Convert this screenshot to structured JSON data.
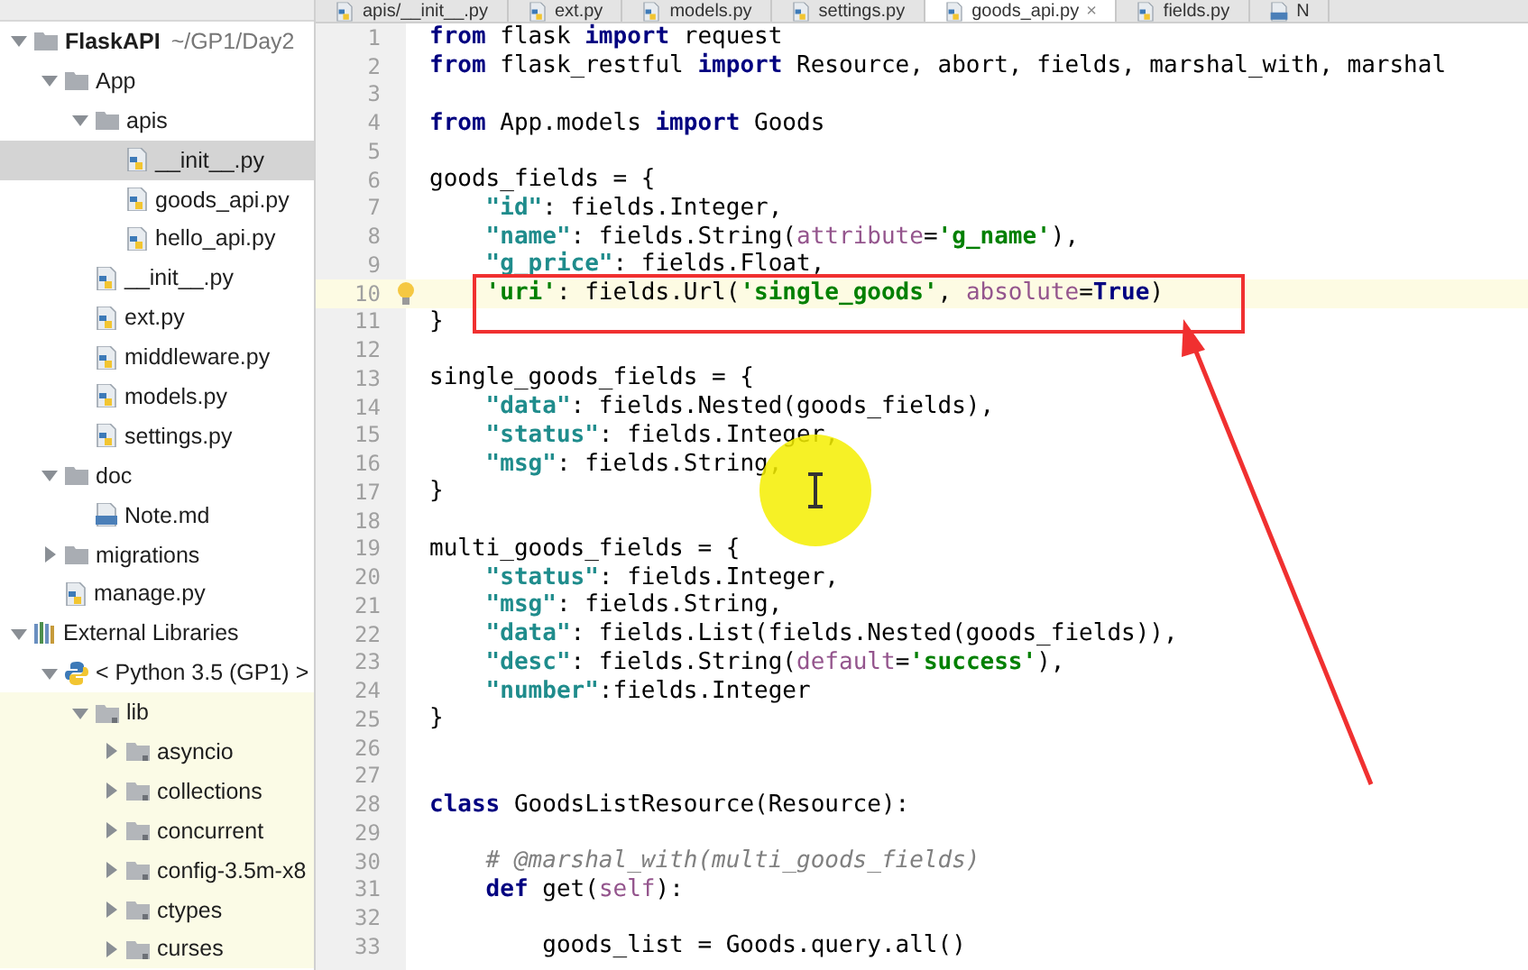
{
  "tabs": [
    {
      "label": "apis/__init__.py",
      "kind": "python",
      "selected": false
    },
    {
      "label": "ext.py",
      "kind": "python",
      "selected": false
    },
    {
      "label": "models.py",
      "kind": "python",
      "selected": false
    },
    {
      "label": "settings.py",
      "kind": "python",
      "selected": false
    },
    {
      "label": "goods_api.py",
      "kind": "python",
      "selected": true,
      "close": "×"
    },
    {
      "label": "fields.py",
      "kind": "python",
      "selected": false
    },
    {
      "label": "N",
      "kind": "md",
      "selected": false
    }
  ],
  "tree": [
    {
      "label": "FlaskAPI",
      "path": "~/GP1/Day2",
      "kind": "folder",
      "expanded": true,
      "selected": false,
      "children": [
        {
          "label": "App",
          "kind": "folder",
          "expanded": true,
          "selected": false,
          "children": [
            {
              "label": "apis",
              "kind": "folder",
              "expanded": true,
              "selected": false,
              "children": [
                {
                  "label": "__init__.py",
                  "kind": "python",
                  "selected": true
                },
                {
                  "label": "goods_api.py",
                  "kind": "python",
                  "selected": false
                },
                {
                  "label": "hello_api.py",
                  "kind": "python",
                  "selected": false
                }
              ]
            },
            {
              "label": "__init__.py",
              "kind": "python",
              "selected": false
            },
            {
              "label": "ext.py",
              "kind": "python",
              "selected": false
            },
            {
              "label": "middleware.py",
              "kind": "python",
              "selected": false
            },
            {
              "label": "models.py",
              "kind": "python",
              "selected": false
            },
            {
              "label": "settings.py",
              "kind": "python",
              "selected": false
            }
          ]
        },
        {
          "label": "doc",
          "kind": "folder",
          "expanded": true,
          "selected": false,
          "children": [
            {
              "label": "Note.md",
              "kind": "md",
              "selected": false
            }
          ]
        },
        {
          "label": "migrations",
          "kind": "folder",
          "expanded": false,
          "selected": false
        },
        {
          "label": "manage.py",
          "kind": "python",
          "selected": false
        }
      ]
    },
    {
      "label": "External Libraries",
      "kind": "library",
      "expanded": true,
      "selected": false,
      "children": [
        {
          "label": "< Python 3.5 (GP1) >",
          "kind": "sdk",
          "expanded": true,
          "selected": false,
          "children": [
            {
              "label": "lib",
              "kind": "libfolder",
              "expanded": true,
              "selected": false,
              "children": [
                {
                  "label": "asyncio",
                  "kind": "libfolder",
                  "expanded": false,
                  "selected": false
                },
                {
                  "label": "collections",
                  "kind": "libfolder",
                  "expanded": false,
                  "selected": false
                },
                {
                  "label": "concurrent",
                  "kind": "libfolder",
                  "expanded": false,
                  "selected": false
                },
                {
                  "label": "config-3.5m-x8",
                  "kind": "libfolder",
                  "expanded": false,
                  "selected": false
                },
                {
                  "label": "ctypes",
                  "kind": "libfolder",
                  "expanded": false,
                  "selected": false
                },
                {
                  "label": "curses",
                  "kind": "libfolder",
                  "expanded": false,
                  "selected": false
                }
              ]
            }
          ]
        }
      ]
    }
  ],
  "code_lines": [
    {
      "number": "1",
      "tokens": [
        {
          "kind": "kw",
          "text": "from"
        },
        {
          "kind": "plain",
          "text": " flask "
        },
        {
          "kind": "kw",
          "text": "import"
        },
        {
          "kind": "plain",
          "text": " request"
        }
      ]
    },
    {
      "number": "2",
      "tokens": [
        {
          "kind": "kw",
          "text": "from"
        },
        {
          "kind": "plain",
          "text": " flask_restful "
        },
        {
          "kind": "kw",
          "text": "import"
        },
        {
          "kind": "plain",
          "text": " Resource, abort, fields, marshal_with, marshal"
        }
      ]
    },
    {
      "number": "3"
    },
    {
      "number": "4",
      "tokens": [
        {
          "kind": "kw",
          "text": "from"
        },
        {
          "kind": "plain",
          "text": " App.models "
        },
        {
          "kind": "kw",
          "text": "import"
        },
        {
          "kind": "plain",
          "text": " Goods"
        }
      ]
    },
    {
      "number": "5"
    },
    {
      "number": "6",
      "tokens": [
        {
          "kind": "plain",
          "text": "goods_fields = {"
        }
      ]
    },
    {
      "number": "7",
      "tokens": [
        {
          "kind": "key",
          "text": "    \"id\""
        },
        {
          "kind": "plain",
          "text": ": fields.Integer,"
        }
      ]
    },
    {
      "number": "8",
      "tokens": [
        {
          "kind": "key",
          "text": "    \"name\""
        },
        {
          "kind": "plain",
          "text": ": fields.String("
        },
        {
          "kind": "param",
          "text": "attribute"
        },
        {
          "kind": "plain",
          "text": "="
        },
        {
          "kind": "str",
          "text": "'g_name'"
        },
        {
          "kind": "plain",
          "text": "),"
        }
      ]
    },
    {
      "number": "9",
      "tokens": [
        {
          "kind": "key",
          "text": "    \"g_price\""
        },
        {
          "kind": "plain",
          "text": ": fields.Float,"
        }
      ]
    },
    {
      "number": "10",
      "current": true,
      "hint": true,
      "tokens": [
        {
          "kind": "str",
          "text": "    'uri'"
        },
        {
          "kind": "plain",
          "text": ": fields.Url("
        },
        {
          "kind": "str",
          "text": "'single_goods'"
        },
        {
          "kind": "plain",
          "text": ", "
        },
        {
          "kind": "param",
          "text": "absolute"
        },
        {
          "kind": "plain",
          "text": "="
        },
        {
          "kind": "kw",
          "text": "True"
        },
        {
          "kind": "plain",
          "text": ")"
        }
      ]
    },
    {
      "number": "11",
      "tokens": [
        {
          "kind": "plain",
          "text": "}"
        }
      ]
    },
    {
      "number": "12"
    },
    {
      "number": "13",
      "tokens": [
        {
          "kind": "plain",
          "text": "single_goods_fields = {"
        }
      ]
    },
    {
      "number": "14",
      "tokens": [
        {
          "kind": "key",
          "text": "    \"data\""
        },
        {
          "kind": "plain",
          "text": ": fields.Nested(goods_fields),"
        }
      ]
    },
    {
      "number": "15",
      "tokens": [
        {
          "kind": "key",
          "text": "    \"status\""
        },
        {
          "kind": "plain",
          "text": ": fields.Integer,"
        }
      ]
    },
    {
      "number": "16",
      "tokens": [
        {
          "kind": "key",
          "text": "    \"msg\""
        },
        {
          "kind": "plain",
          "text": ": fields.String,"
        }
      ]
    },
    {
      "number": "17",
      "tokens": [
        {
          "kind": "plain",
          "text": "}"
        }
      ]
    },
    {
      "number": "18"
    },
    {
      "number": "19",
      "tokens": [
        {
          "kind": "plain",
          "text": "multi_goods_fields = {"
        }
      ]
    },
    {
      "number": "20",
      "tokens": [
        {
          "kind": "key",
          "text": "    \"status\""
        },
        {
          "kind": "plain",
          "text": ": fields.Integer,"
        }
      ]
    },
    {
      "number": "21",
      "tokens": [
        {
          "kind": "key",
          "text": "    \"msg\""
        },
        {
          "kind": "plain",
          "text": ": fields.String,"
        }
      ]
    },
    {
      "number": "22",
      "tokens": [
        {
          "kind": "key",
          "text": "    \"data\""
        },
        {
          "kind": "plain",
          "text": ": fields.List(fields.Nested(goods_fields)),"
        }
      ]
    },
    {
      "number": "23",
      "tokens": [
        {
          "kind": "key",
          "text": "    \"desc\""
        },
        {
          "kind": "plain",
          "text": ": fields.String("
        },
        {
          "kind": "param",
          "text": "default"
        },
        {
          "kind": "plain",
          "text": "="
        },
        {
          "kind": "str",
          "text": "'success'"
        },
        {
          "kind": "plain",
          "text": "),"
        }
      ]
    },
    {
      "number": "24",
      "tokens": [
        {
          "kind": "key",
          "text": "    \"number\""
        },
        {
          "kind": "plain",
          "text": ":fields.Integer"
        }
      ]
    },
    {
      "number": "25",
      "tokens": [
        {
          "kind": "plain",
          "text": "}"
        }
      ]
    },
    {
      "number": "26"
    },
    {
      "number": "27"
    },
    {
      "number": "28",
      "tokens": [
        {
          "kind": "kw",
          "text": "class"
        },
        {
          "kind": "plain",
          "text": " GoodsListResource(Resource):"
        }
      ]
    },
    {
      "number": "29"
    },
    {
      "number": "30",
      "tokens": [
        {
          "kind": "comment",
          "text": "    # @marshal_with(multi_goods_fields)"
        }
      ]
    },
    {
      "number": "31",
      "tokens": [
        {
          "kind": "kw",
          "text": "    def"
        },
        {
          "kind": "plain",
          "text": " get("
        },
        {
          "kind": "param",
          "text": "self"
        },
        {
          "kind": "plain",
          "text": "):"
        }
      ]
    },
    {
      "number": "32"
    },
    {
      "number": "33",
      "tokens": [
        {
          "kind": "plain",
          "text": "        goods_list = Goods.query.all()"
        }
      ]
    }
  ]
}
